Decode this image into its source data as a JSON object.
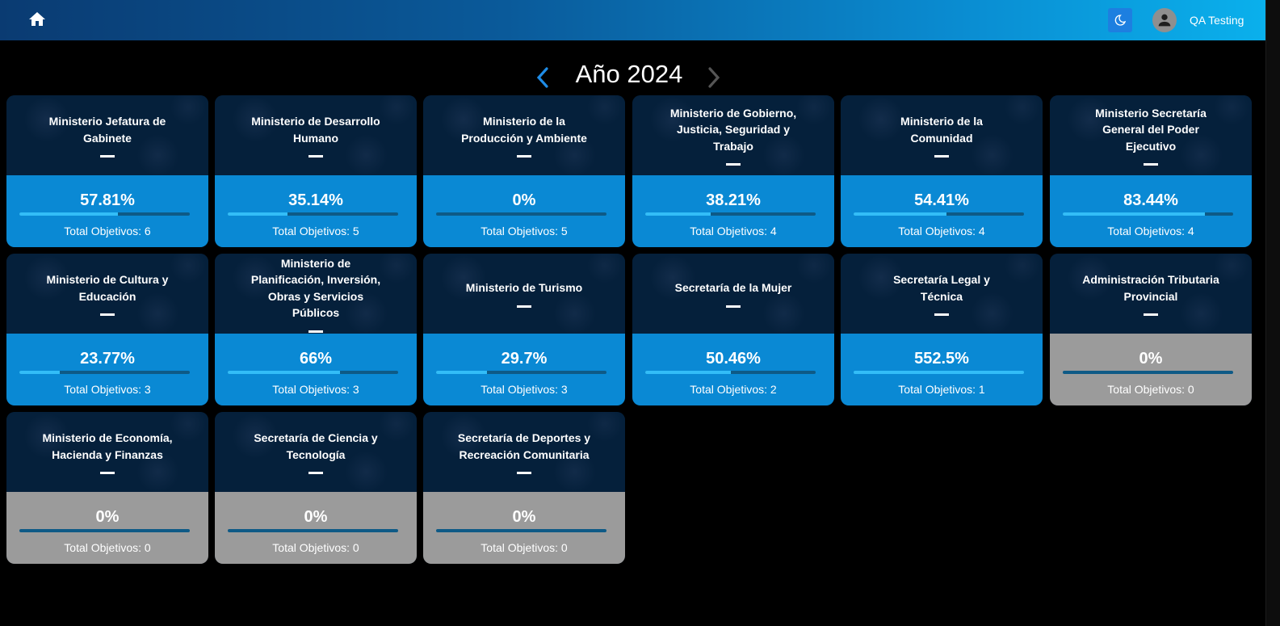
{
  "header": {
    "home_icon": "home-icon",
    "theme_icon": "moon-icon",
    "avatar_icon": "user-icon",
    "username": "QA Testing"
  },
  "year_nav": {
    "title": "Año 2024",
    "prev_icon": "chevron-left-icon",
    "next_icon": "chevron-right-icon"
  },
  "colors": {
    "active_bottom": "#0a89d4",
    "inactive_bottom": "#9b9b9b",
    "card_top": "#05203b",
    "bar_track": "#0e5a86",
    "bar_fill": "#33bdf7"
  },
  "cards": [
    {
      "name": "Ministerio Jefatura de Gabinete",
      "percent_label": "57.81%",
      "progress": 57.81,
      "total_label": "Total Objetivos: 6",
      "status": "active"
    },
    {
      "name": "Ministerio de Desarrollo Humano",
      "percent_label": "35.14%",
      "progress": 35.14,
      "total_label": "Total Objetivos: 5",
      "status": "active"
    },
    {
      "name": "Ministerio de la Producción y Ambiente",
      "percent_label": "0%",
      "progress": 0,
      "total_label": "Total Objetivos: 5",
      "status": "active"
    },
    {
      "name": "Ministerio de Gobierno, Justicia, Seguridad y Trabajo",
      "percent_label": "38.21%",
      "progress": 38.21,
      "total_label": "Total Objetivos: 4",
      "status": "active"
    },
    {
      "name": "Ministerio de la Comunidad",
      "percent_label": "54.41%",
      "progress": 54.41,
      "total_label": "Total Objetivos: 4",
      "status": "active"
    },
    {
      "name": "Ministerio Secretaría General del Poder Ejecutivo",
      "percent_label": "83.44%",
      "progress": 83.44,
      "total_label": "Total Objetivos: 4",
      "status": "active"
    },
    {
      "name": "Ministerio de Cultura y Educación",
      "percent_label": "23.77%",
      "progress": 23.77,
      "total_label": "Total Objetivos: 3",
      "status": "active"
    },
    {
      "name": "Ministerio de Planificación, Inversión, Obras y Servicios Públicos",
      "percent_label": "66%",
      "progress": 66,
      "total_label": "Total Objetivos: 3",
      "status": "active"
    },
    {
      "name": "Ministerio de Turismo",
      "percent_label": "29.7%",
      "progress": 29.7,
      "total_label": "Total Objetivos: 3",
      "status": "active"
    },
    {
      "name": "Secretaría de la Mujer",
      "percent_label": "50.46%",
      "progress": 50.46,
      "total_label": "Total Objetivos: 2",
      "status": "active"
    },
    {
      "name": "Secretaría Legal y Técnica",
      "percent_label": "552.5%",
      "progress": 100,
      "total_label": "Total Objetivos: 1",
      "status": "active"
    },
    {
      "name": "Administración Tributaria Provincial",
      "percent_label": "0%",
      "progress": 0,
      "total_label": "Total Objetivos: 0",
      "status": "inactive"
    },
    {
      "name": "Ministerio de Economía, Hacienda y Finanzas",
      "percent_label": "0%",
      "progress": 0,
      "total_label": "Total Objetivos: 0",
      "status": "inactive"
    },
    {
      "name": "Secretaría de Ciencia y Tecnología",
      "percent_label": "0%",
      "progress": 0,
      "total_label": "Total Objetivos: 0",
      "status": "inactive"
    },
    {
      "name": "Secretaría de Deportes y Recreación Comunitaria",
      "percent_label": "0%",
      "progress": 0,
      "total_label": "Total Objetivos: 0",
      "status": "inactive"
    }
  ]
}
